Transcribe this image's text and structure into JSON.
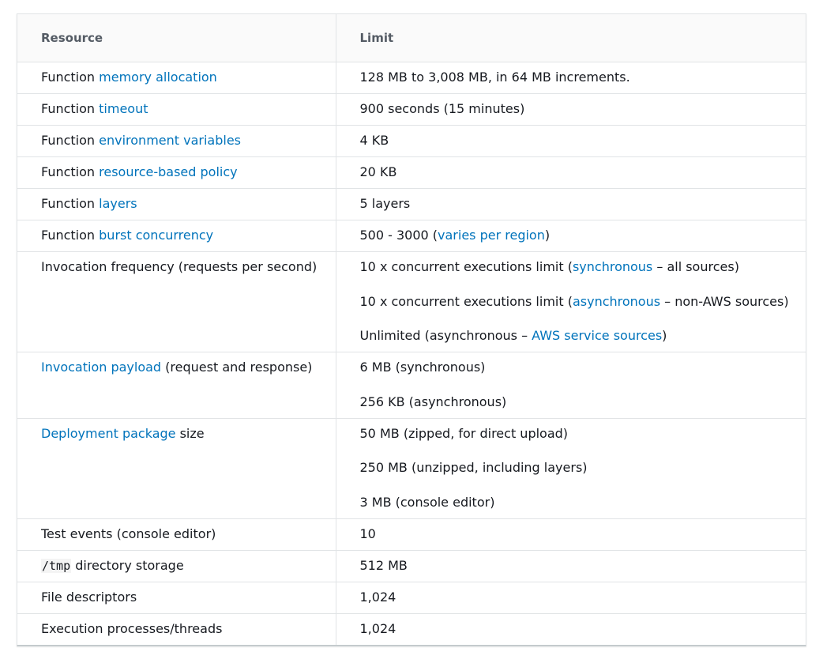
{
  "table": {
    "headers": [
      "Resource",
      "Limit"
    ],
    "rows": [
      {
        "resource": [
          {
            "t": "Function "
          },
          {
            "t": "memory allocation",
            "link": true
          }
        ],
        "limits": [
          [
            {
              "t": "128 MB to 3,008 MB, in 64 MB increments."
            }
          ]
        ]
      },
      {
        "resource": [
          {
            "t": "Function "
          },
          {
            "t": "timeout",
            "link": true
          }
        ],
        "limits": [
          [
            {
              "t": "900 seconds (15 minutes)"
            }
          ]
        ]
      },
      {
        "resource": [
          {
            "t": "Function "
          },
          {
            "t": "environment variables",
            "link": true
          }
        ],
        "limits": [
          [
            {
              "t": "4 KB"
            }
          ]
        ]
      },
      {
        "resource": [
          {
            "t": "Function "
          },
          {
            "t": "resource-based policy",
            "link": true
          }
        ],
        "limits": [
          [
            {
              "t": "20 KB"
            }
          ]
        ]
      },
      {
        "resource": [
          {
            "t": "Function "
          },
          {
            "t": "layers",
            "link": true
          }
        ],
        "limits": [
          [
            {
              "t": "5 layers"
            }
          ]
        ]
      },
      {
        "resource": [
          {
            "t": "Function "
          },
          {
            "t": "burst concurrency",
            "link": true
          }
        ],
        "limits": [
          [
            {
              "t": "500 - 3000 ("
            },
            {
              "t": "varies per region",
              "link": true
            },
            {
              "t": ")"
            }
          ]
        ]
      },
      {
        "resource": [
          {
            "t": "Invocation frequency (requests per second)"
          }
        ],
        "limits": [
          [
            {
              "t": "10 x concurrent executions limit ("
            },
            {
              "t": "synchronous",
              "link": true
            },
            {
              "t": " – all sources)"
            }
          ],
          [
            {
              "t": "10 x concurrent executions limit ("
            },
            {
              "t": "asynchronous",
              "link": true
            },
            {
              "t": " – non-AWS sources)"
            }
          ],
          [
            {
              "t": "Unlimited (asynchronous – "
            },
            {
              "t": "AWS service sources",
              "link": true
            },
            {
              "t": ")"
            }
          ]
        ]
      },
      {
        "resource": [
          {
            "t": "Invocation payload",
            "link": true
          },
          {
            "t": " (request and response)"
          }
        ],
        "limits": [
          [
            {
              "t": "6 MB (synchronous)"
            }
          ],
          [
            {
              "t": "256 KB (asynchronous)"
            }
          ]
        ]
      },
      {
        "resource": [
          {
            "t": "Deployment package",
            "link": true
          },
          {
            "t": " size"
          }
        ],
        "limits": [
          [
            {
              "t": "50 MB (zipped, for direct upload)"
            }
          ],
          [
            {
              "t": "250 MB (unzipped, including layers)"
            }
          ],
          [
            {
              "t": "3 MB (console editor)"
            }
          ]
        ]
      },
      {
        "resource": [
          {
            "t": "Test events (console editor)"
          }
        ],
        "limits": [
          [
            {
              "t": "10"
            }
          ]
        ]
      },
      {
        "resource": [
          {
            "t": "/tmp",
            "code": true
          },
          {
            "t": " directory storage"
          }
        ],
        "limits": [
          [
            {
              "t": "512 MB"
            }
          ]
        ]
      },
      {
        "resource": [
          {
            "t": "File descriptors"
          }
        ],
        "limits": [
          [
            {
              "t": "1,024"
            }
          ]
        ]
      },
      {
        "resource": [
          {
            "t": "Execution processes/threads"
          }
        ],
        "limits": [
          [
            {
              "t": "1,024"
            }
          ]
        ]
      }
    ]
  },
  "colors": {
    "link": "#0073bb",
    "text": "#16191f",
    "header_text": "#545b64",
    "border": "#e1e4e6"
  }
}
